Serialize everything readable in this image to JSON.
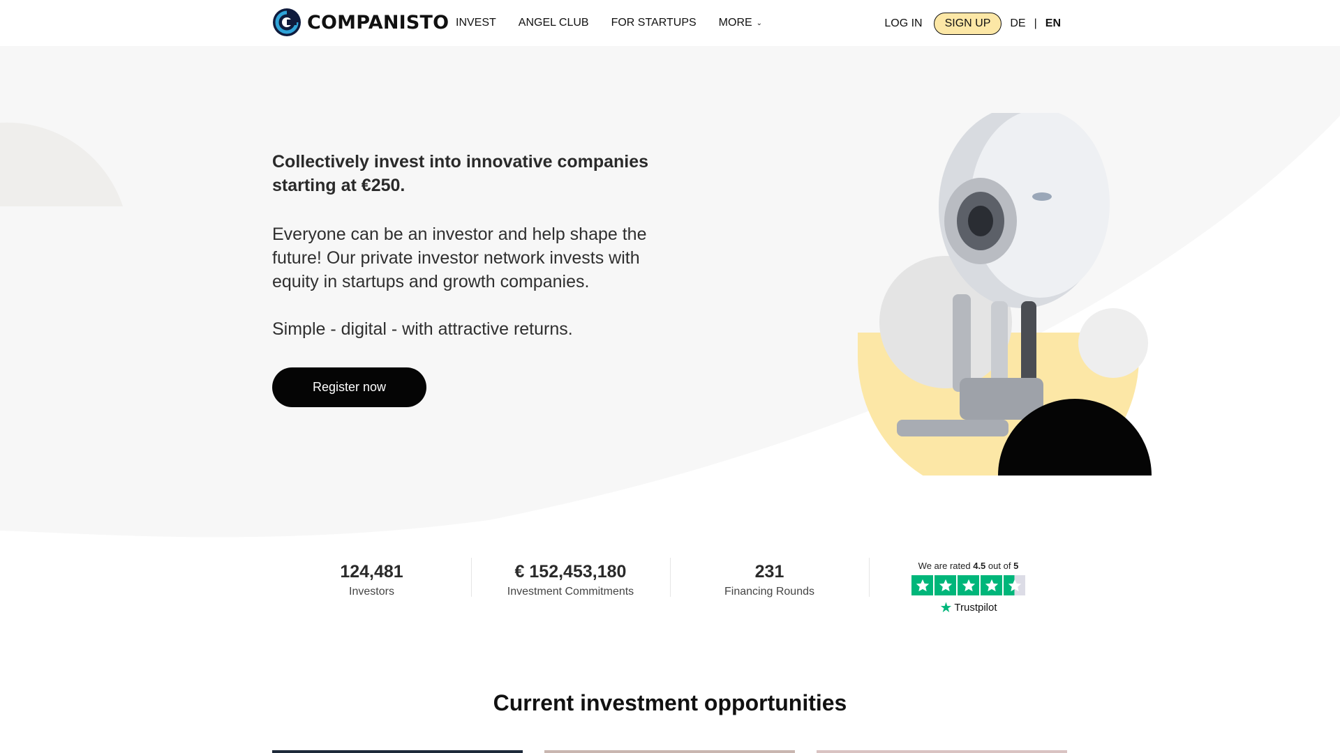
{
  "header": {
    "logo_text": "COMPANISTO",
    "nav": [
      "INVEST",
      "ANGEL CLUB",
      "FOR STARTUPS",
      "MORE"
    ],
    "login": "LOG IN",
    "signup": "SIGN UP",
    "lang_de": "DE",
    "lang_sep": "|",
    "lang_en": "EN"
  },
  "hero": {
    "title": "Collectively invest into innovative companies starting at €250.",
    "description": "Everyone can be an investor and help shape the future! Our private investor network invests with equity in startups and growth companies.",
    "tagline": "Simple - digital - with attractive returns.",
    "cta": "Register now"
  },
  "stats": [
    {
      "value": "124,481",
      "label": "Investors"
    },
    {
      "value": "€ 152,453,180",
      "label": "Investment Commitments"
    },
    {
      "value": "231",
      "label": "Financing Rounds"
    }
  ],
  "trustpilot": {
    "prefix": "We are rated",
    "rating": "4.5",
    "middle": "out of",
    "max": "5",
    "brand": "Trustpilot",
    "stars_filled": 4.5
  },
  "section": {
    "title": "Current investment opportunities"
  },
  "colors": {
    "accent_yellow": "#fce7a6",
    "trustpilot_green": "#00b67a",
    "button_black": "#050505"
  }
}
